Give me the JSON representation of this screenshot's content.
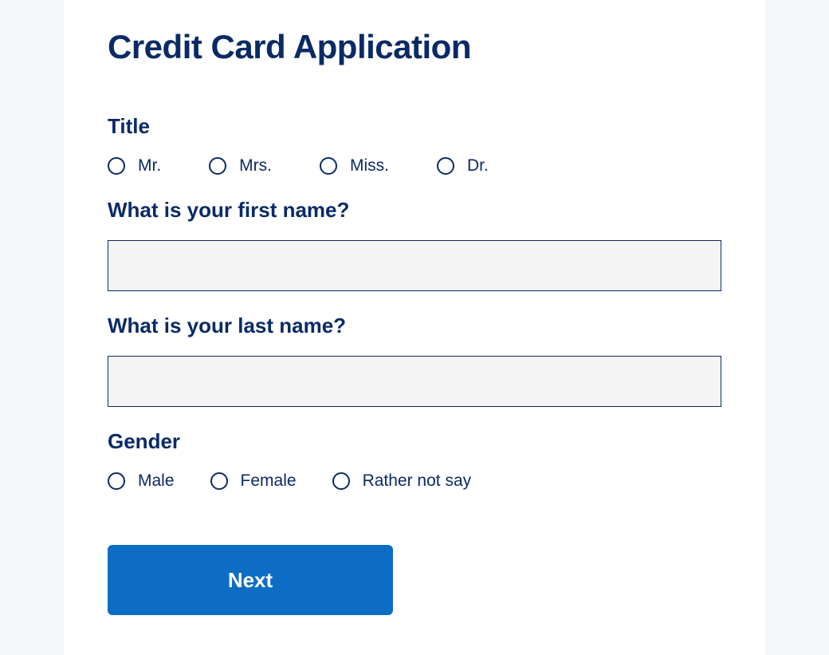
{
  "page": {
    "title": "Credit Card Application"
  },
  "form": {
    "title": {
      "label": "Title",
      "options": [
        "Mr.",
        "Mrs.",
        "Miss.",
        "Dr."
      ]
    },
    "firstName": {
      "label": "What is your first name?",
      "value": ""
    },
    "lastName": {
      "label": "What is your last name?",
      "value": ""
    },
    "gender": {
      "label": "Gender",
      "options": [
        "Male",
        "Female",
        "Rather not say"
      ]
    },
    "nextButton": "Next"
  }
}
